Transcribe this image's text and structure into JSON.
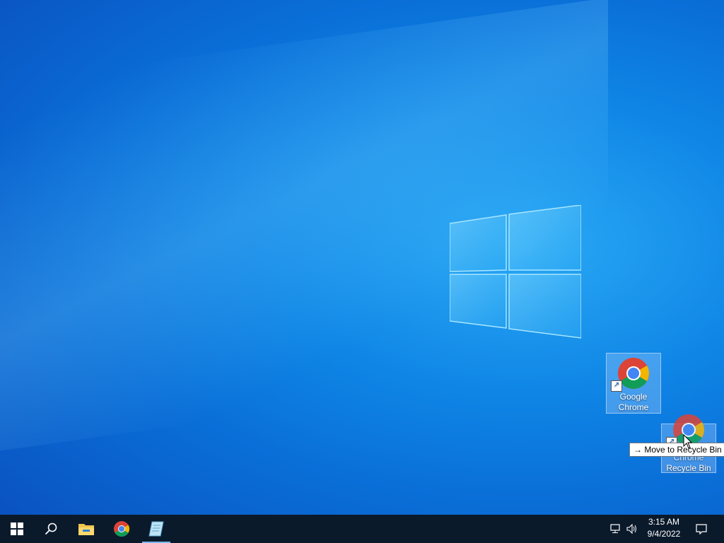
{
  "desktop": {
    "icons": [
      {
        "label_line1": "Google",
        "label_line2": "Chrome",
        "icon": "chrome-icon",
        "selected": true
      },
      {
        "label_line1": "Chrome",
        "label_line2": "Recycle Bin",
        "icon": "chrome-icon",
        "selected": true
      }
    ],
    "drag_tooltip": {
      "arrow": "→",
      "text": "Move to Recycle Bin"
    }
  },
  "taskbar": {
    "start_icon": "windows-start-icon",
    "search_icon": "search-icon",
    "pinned": [
      {
        "name": "file-explorer-icon"
      },
      {
        "name": "chrome-icon"
      },
      {
        "name": "notepad-icon"
      }
    ],
    "tray": {
      "network_icon": "network-icon",
      "volume_icon": "volume-icon",
      "time": "3:15 AM",
      "date": "9/4/2022",
      "notifications_icon": "action-center-icon"
    }
  },
  "colors": {
    "accent": "#0a78d7",
    "taskbar": "#0b1a2b",
    "tile_highlight": "#aacdff"
  }
}
